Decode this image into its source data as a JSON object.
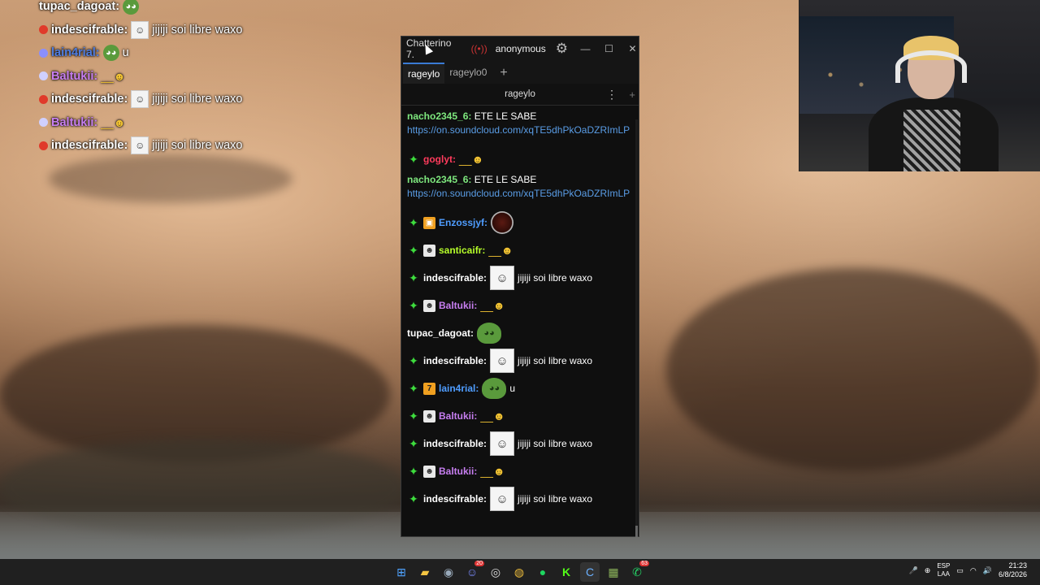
{
  "overlay_chat": [
    {
      "name": "tupac_dagoat:",
      "name_color": "#ffffff",
      "badge_color": "",
      "emote": "pepe",
      "text": ""
    },
    {
      "name": "indescifrable:",
      "name_color": "#ffffff",
      "badge_color": "#e03a2a",
      "emote": "white",
      "text": "jijiji soi libre waxo"
    },
    {
      "name": "lain4rial:",
      "name_color": "#4f7de0",
      "badge_color": "#8a8fff",
      "emote": "pepe",
      "text": "u"
    },
    {
      "name": "Baltukii:",
      "name_color": "#c77ef0",
      "badge_color": "#d0d0ff",
      "emote": "smug",
      "text": ""
    },
    {
      "name": "indescifrable:",
      "name_color": "#ffffff",
      "badge_color": "#e03a2a",
      "emote": "white",
      "text": "jijiji soi libre waxo"
    },
    {
      "name": "Baltukii:",
      "name_color": "#c77ef0",
      "badge_color": "#d0d0ff",
      "emote": "smug",
      "text": ""
    },
    {
      "name": "indescifrable:",
      "name_color": "#ffffff",
      "badge_color": "#e03a2a",
      "emote": "white",
      "text": "jijiji soi libre waxo"
    }
  ],
  "window": {
    "title": "Chatterino 7.",
    "user": "anonymous",
    "tabs": [
      "rageylo",
      "rageylo0"
    ],
    "channel": "rageylo"
  },
  "messages": [
    {
      "kind": "link",
      "user": "nacho2345_6:",
      "user_color": "#7ee87e",
      "text": "ETE LE SABE",
      "link": "https://on.soundcloud.com/xqTE5dhPkOaDZRImLP"
    },
    {
      "kind": "emote",
      "sparkle": true,
      "badge": "",
      "user": "goglyt:",
      "user_color": "#ff3b5c",
      "emote": "smug",
      "text": ""
    },
    {
      "kind": "link",
      "user": "nacho2345_6:",
      "user_color": "#7ee87e",
      "text": "ETE LE SABE",
      "link": "https://on.soundcloud.com/xqTE5dhPkOaDZRImLP"
    },
    {
      "kind": "emote",
      "sparkle": true,
      "badge": "box",
      "user": "Enzossjyf:",
      "user_color": "#4f9dff",
      "emote": "cup",
      "text": ""
    },
    {
      "kind": "emote",
      "sparkle": true,
      "badge": "face",
      "user": "santicaifr:",
      "user_color": "#b7ff2a",
      "emote": "smug",
      "text": ""
    },
    {
      "kind": "emote",
      "sparkle": true,
      "badge": "",
      "user": "indescifrable:",
      "user_color": "#ffffff",
      "emote": "white",
      "text": "jijiji soi libre waxo"
    },
    {
      "kind": "emote",
      "sparkle": true,
      "badge": "face",
      "user": "Baltukii:",
      "user_color": "#c77ef0",
      "emote": "smug",
      "text": ""
    },
    {
      "kind": "emote",
      "sparkle": false,
      "badge": "",
      "user": "tupac_dagoat:",
      "user_color": "#ffffff",
      "emote": "pepe",
      "text": ""
    },
    {
      "kind": "emote",
      "sparkle": true,
      "badge": "",
      "user": "indescifrable:",
      "user_color": "#ffffff",
      "emote": "white",
      "text": "jijiji soi libre waxo"
    },
    {
      "kind": "emote",
      "sparkle": true,
      "badge": "7tv",
      "user": "lain4rial:",
      "user_color": "#4f9dff",
      "emote": "pepe",
      "text": "u"
    },
    {
      "kind": "emote",
      "sparkle": true,
      "badge": "face",
      "user": "Baltukii:",
      "user_color": "#c77ef0",
      "emote": "smug",
      "text": ""
    },
    {
      "kind": "emote",
      "sparkle": true,
      "badge": "",
      "user": "indescifrable:",
      "user_color": "#ffffff",
      "emote": "white",
      "text": "jijiji soi libre waxo"
    },
    {
      "kind": "emote",
      "sparkle": true,
      "badge": "face",
      "user": "Baltukii:",
      "user_color": "#c77ef0",
      "emote": "smug",
      "text": ""
    },
    {
      "kind": "emote",
      "sparkle": true,
      "badge": "",
      "user": "indescifrable:",
      "user_color": "#ffffff",
      "emote": "white",
      "text": "jijiji soi libre waxo"
    }
  ],
  "taskbar": {
    "icons": [
      "windows-start-icon",
      "file-explorer-icon",
      "steam-icon",
      "discord-icon",
      "obs-icon",
      "chrome-icon",
      "spotify-icon",
      "kick-icon",
      "chatterino-icon",
      "minecraft-icon",
      "whatsapp-icon"
    ],
    "discord_badge": "20",
    "whatsapp_badge": "63",
    "lang_top": "ESP",
    "lang_bottom": "LAA",
    "time": "21:23",
    "date": "6/8/2026"
  }
}
